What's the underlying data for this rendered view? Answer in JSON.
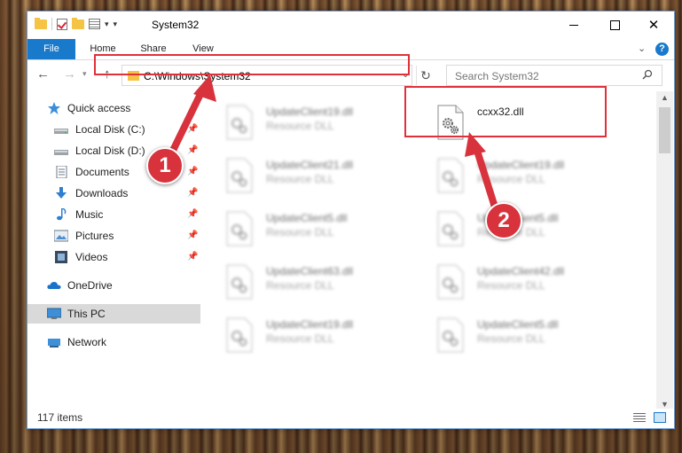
{
  "window": {
    "title": "System32",
    "controls": {
      "minimize": "minimize",
      "maximize": "maximize",
      "close": "✕"
    }
  },
  "ribbon": {
    "tabs": [
      "File",
      "Home",
      "Share",
      "View"
    ],
    "help": "?"
  },
  "navigation": {
    "address": "C:\\Windows\\System32",
    "search_placeholder": "Search System32"
  },
  "sidebar": {
    "items": [
      {
        "label": "Quick access",
        "icon": "star-icon",
        "pinned": false
      },
      {
        "label": "Local Disk (C:)",
        "icon": "drive-icon",
        "pinned": true
      },
      {
        "label": "Local Disk (D:)",
        "icon": "drive-icon",
        "pinned": true
      },
      {
        "label": "Documents",
        "icon": "documents-icon",
        "pinned": true
      },
      {
        "label": "Downloads",
        "icon": "downloads-icon",
        "pinned": true
      },
      {
        "label": "Music",
        "icon": "music-icon",
        "pinned": true
      },
      {
        "label": "Pictures",
        "icon": "pictures-icon",
        "pinned": true
      },
      {
        "label": "Videos",
        "icon": "videos-icon",
        "pinned": true
      },
      {
        "label": "OneDrive",
        "icon": "onedrive-icon",
        "pinned": false
      },
      {
        "label": "This PC",
        "icon": "computer-icon",
        "pinned": false,
        "selected": true
      },
      {
        "label": "Network",
        "icon": "network-icon",
        "pinned": false
      }
    ]
  },
  "files": {
    "left_column": [
      {
        "name": "UpdateClient19.dll",
        "type": "Resource DLL"
      },
      {
        "name": "UpdateClient21.dll",
        "type": "Resource DLL"
      },
      {
        "name": "UpdateClient5.dll",
        "type": "Resource DLL"
      },
      {
        "name": "UpdateClient63.dll",
        "type": "Resource DLL"
      },
      {
        "name": "UpdateClient19.dll",
        "type": "Resource DLL"
      }
    ],
    "right_column": [
      {
        "name": "ccxx32.dll",
        "type": ""
      },
      {
        "name": "UpdateClient19.dll",
        "type": "Resource DLL"
      },
      {
        "name": "UpdateClient5.dll",
        "type": "Resource DLL"
      },
      {
        "name": "UpdateClient42.dll",
        "type": "Resource DLL"
      },
      {
        "name": "UpdateClient5.dll",
        "type": "Resource DLL"
      }
    ]
  },
  "status": {
    "item_count": "117 items"
  },
  "callouts": {
    "step1": "1",
    "step2": "2"
  },
  "colors": {
    "accent": "#1979ca",
    "highlight": "#e0303a",
    "badge": "#d8323c",
    "folder": "#f5c445"
  }
}
